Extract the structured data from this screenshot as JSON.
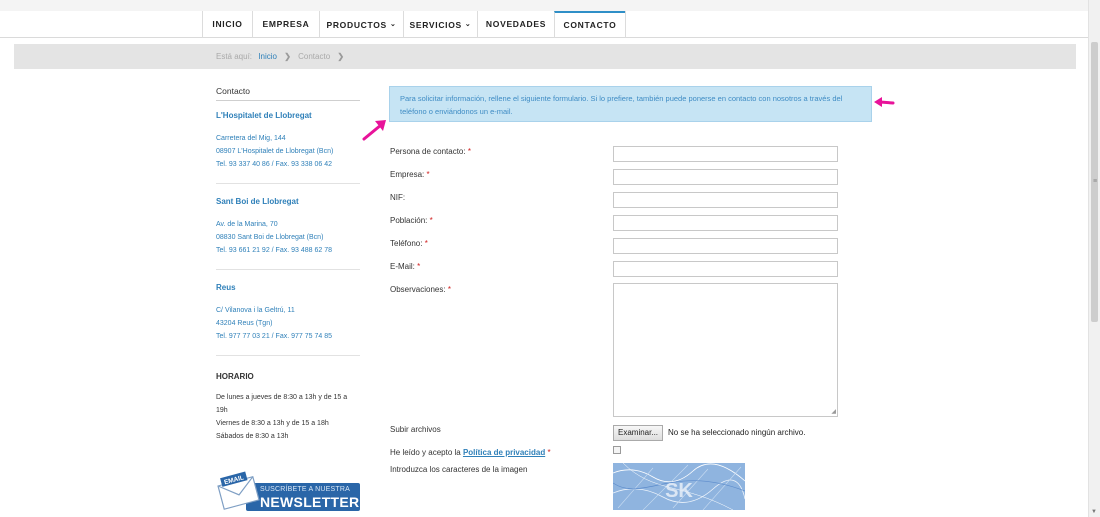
{
  "nav": {
    "items": [
      {
        "label": "INICIO",
        "dropdown": false,
        "active": false
      },
      {
        "label": "EMPRESA",
        "dropdown": false,
        "active": false
      },
      {
        "label": "PRODUCTOS",
        "dropdown": true,
        "active": false
      },
      {
        "label": "SERVICIOS",
        "dropdown": true,
        "active": false
      },
      {
        "label": "NOVEDADES",
        "dropdown": false,
        "active": false
      },
      {
        "label": "CONTACTO",
        "dropdown": false,
        "active": true
      }
    ],
    "chevron_icon": "chevron-down-icon"
  },
  "breadcrumb": {
    "prefix": "Está aquí:",
    "home": "Inicio",
    "current": "Contacto",
    "separator": "❯"
  },
  "sidebar": {
    "title": "Contacto",
    "offices": [
      {
        "name": "L'Hospitalet de Llobregat",
        "lines": [
          "Carretera del Mig, 144",
          "08907 L'Hospitalet de Llobregat (Bcn)",
          "Tel. 93 337 40 86 / Fax. 93 338 06 42"
        ]
      },
      {
        "name": "Sant Boi de Llobregat",
        "lines": [
          "Av. de la Marina, 70",
          "08830 Sant Boi de Llobregat (Bcn)",
          "Tel. 93 661 21 92 / Fax. 93 488 62 78"
        ]
      },
      {
        "name": "Reus",
        "lines": [
          "C/ Vilanova i la Geltrú, 11",
          "43204 Reus (Tgn)",
          "Tel. 977 77 03 21 / Fax. 977 75 74 85"
        ]
      }
    ],
    "horario": {
      "title": "HORARIO",
      "lines": [
        "De lunes a jueves de 8:30 a 13h y de 15 a",
        "19h",
        "Viernes de 8:30 a 13h y de 15 a 18h",
        "Sábados de 8:30 a 13h"
      ]
    },
    "newsletter": {
      "badge": "EMAIL",
      "small": "SUSCRÍBETE A NUESTRA",
      "big": "NEWSLETTER"
    }
  },
  "form": {
    "info": "Para solicitar información, rellene el siguiente formulario. Si lo prefiere, también puede ponerse en contacto con nosotros a través del teléfono o enviándonos un e-mail.",
    "fields": [
      {
        "label": "Persona de contacto:",
        "required": true,
        "value": ""
      },
      {
        "label": "Empresa:",
        "required": true,
        "value": ""
      },
      {
        "label": "NIF:",
        "required": false,
        "value": ""
      },
      {
        "label": "Población:",
        "required": true,
        "value": ""
      },
      {
        "label": "Teléfono:",
        "required": true,
        "value": ""
      },
      {
        "label": "E-Mail:",
        "required": true,
        "value": ""
      }
    ],
    "observaciones_label": "Observaciones:",
    "required_mark": "*",
    "upload": {
      "label": "Subir archivos",
      "button": "Examinar...",
      "status": "No se ha seleccionado ningún archivo."
    },
    "privacy": {
      "prefix": "He leído y acepto la",
      "link": "Política de privacidad",
      "required": "*",
      "checked": false
    },
    "captcha": {
      "label": "Introduzca los caracteres de la imagen",
      "text": "SK"
    }
  },
  "annotations": {
    "arrow_color": "#e8139a"
  },
  "colors": {
    "accent": "#2f80b9",
    "info_bg": "#c6e4f4",
    "required": "#d02020"
  }
}
